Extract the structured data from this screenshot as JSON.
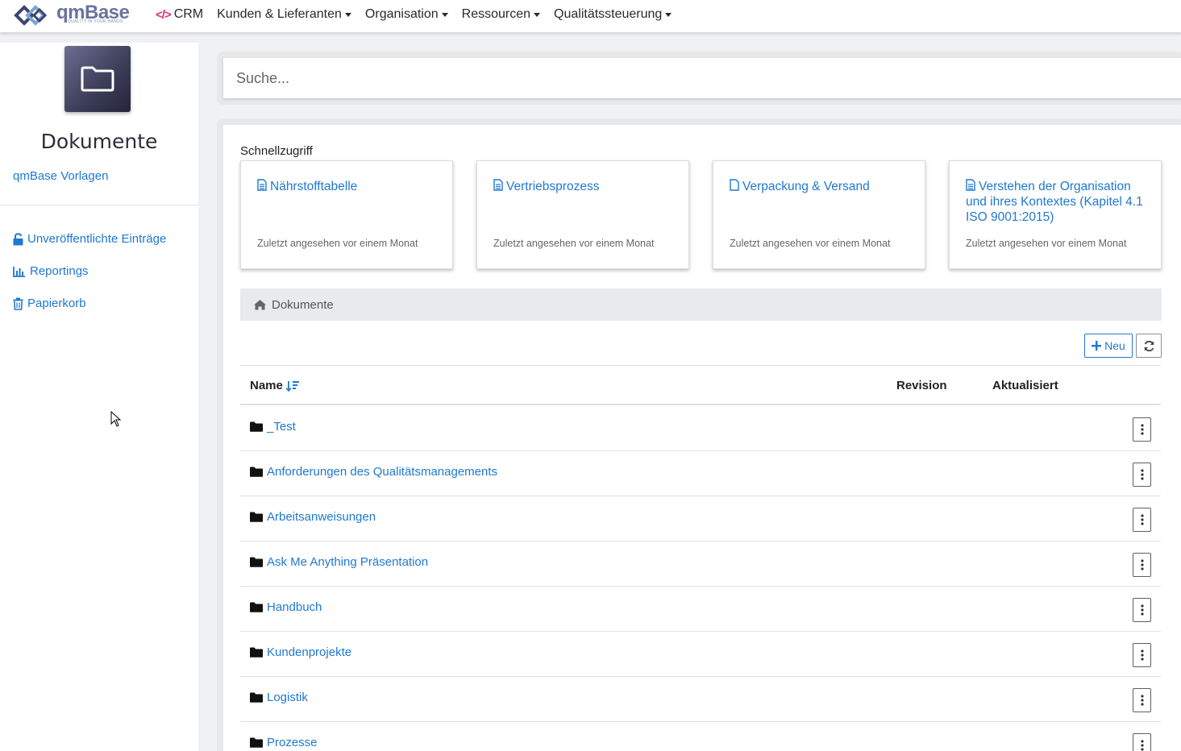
{
  "brand": {
    "name": "qmBase",
    "tagline": "QUALITY IN YOUR HANDS"
  },
  "nav": {
    "crm": "CRM",
    "items": [
      "Kunden & Lieferanten",
      "Organisation",
      "Ressourcen",
      "Qualitätssteuerung"
    ]
  },
  "sidebar": {
    "title": "Dokumente",
    "vorlagen": "qmBase Vorlagen",
    "links": [
      {
        "label": "Unveröffentlichte Einträge",
        "icon": "unlock-icon"
      },
      {
        "label": "Reportings",
        "icon": "bar-chart-icon"
      },
      {
        "label": "Papierkorb",
        "icon": "trash-icon"
      }
    ]
  },
  "search": {
    "placeholder": "Suche..."
  },
  "quick_access": {
    "label": "Schnellzugriff",
    "cards": [
      {
        "title": "Nährstofftabelle",
        "subtitle": "Zuletzt angesehen vor einem Monat"
      },
      {
        "title": "Vertriebsprozess",
        "subtitle": "Zuletzt angesehen vor einem Monat"
      },
      {
        "title": "Verpackung & Versand",
        "subtitle": "Zuletzt angesehen vor einem Monat"
      },
      {
        "title": "Verstehen der Organisation und ihres Kontextes (Kapitel 4.1 ISO 9001:2015)",
        "subtitle": "Zuletzt angesehen vor einem Monat"
      }
    ]
  },
  "breadcrumb": {
    "home": "Dokumente"
  },
  "toolbar": {
    "new_label": "Neu"
  },
  "table": {
    "columns": {
      "name": "Name",
      "revision": "Revision",
      "updated": "Aktualisiert"
    },
    "rows": [
      {
        "name": "_Test"
      },
      {
        "name": "Anforderungen des Qualitätsmanagements"
      },
      {
        "name": "Arbeitsanweisungen"
      },
      {
        "name": "Ask Me Anything Präsentation"
      },
      {
        "name": "Handbuch"
      },
      {
        "name": "Kundenprojekte"
      },
      {
        "name": "Logistik"
      },
      {
        "name": "Prozesse"
      }
    ]
  },
  "colors": {
    "accent": "#1f78d1",
    "crm_icon": "#e0307a",
    "logo": "#6a73a0"
  }
}
